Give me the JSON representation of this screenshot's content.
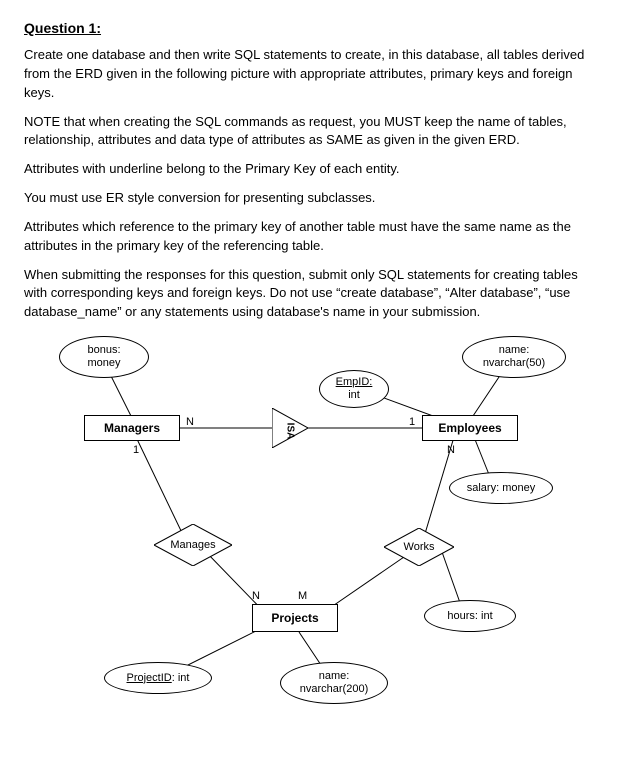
{
  "heading": "Question 1:",
  "p1": "Create one database and then write SQL statements to create, in this database, all tables derived from the ERD given in the following picture with appropriate attributes, primary keys and foreign keys.",
  "p2": "NOTE that when creating the SQL commands as request, you MUST keep the name of tables, relationship, attributes and data type of attributes as SAME as given in the given ERD.",
  "p3": "Attributes with underline belong to the Primary Key of each entity.",
  "p4": "You must use ER style conversion for presenting subclasses.",
  "p5": "Attributes which reference to the primary key of another table must have the same name as the attributes in the primary key of the referencing table.",
  "p6": "When submitting the responses for this question, submit only SQL statements for creating tables with corresponding keys and foreign keys. Do not use “create database”, “Alter database”, “use database_name” or any statements using database's name in your submission.",
  "erd": {
    "bonus": {
      "l1": "bonus:",
      "l2": "money"
    },
    "name_emp": {
      "l1": "name:",
      "l2": "nvarchar(50)"
    },
    "empid": {
      "l1": "EmpID:",
      "l2": "int"
    },
    "salary": {
      "text": "salary: money"
    },
    "hours": {
      "text": "hours: int"
    },
    "projectid": {
      "l1": "ProjectID",
      "l2": ": int"
    },
    "name_proj": {
      "l1": "name:",
      "l2": "nvarchar(200)"
    },
    "managers": "Managers",
    "employees": "Employees",
    "projects": "Projects",
    "manages": "Manages",
    "works": "Works",
    "isa": "ISA",
    "card": {
      "n1": "N",
      "one": "1",
      "n2": "N",
      "one2": "1",
      "n3": "N",
      "m": "M"
    }
  }
}
